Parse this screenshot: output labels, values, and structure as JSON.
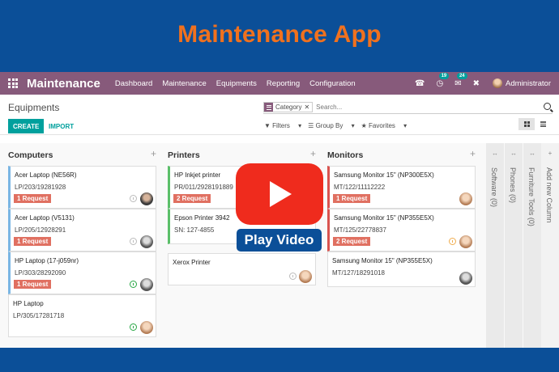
{
  "banner": {
    "title": "Maintenance App"
  },
  "navbar": {
    "brand": "Maintenance",
    "menu": [
      "Dashboard",
      "Maintenance",
      "Equipments",
      "Reporting",
      "Configuration"
    ],
    "activity_badge": "19",
    "messages_badge": "24",
    "user": "Administrator",
    "accent": "#875a7b"
  },
  "control_panel": {
    "breadcrumb": "Equipments",
    "facet": "Category",
    "search_placeholder": "Search...",
    "create": "CREATE",
    "import": "IMPORT",
    "filters": "Filters",
    "group_by": "Group By",
    "favorites": "Favorites"
  },
  "columns": [
    {
      "title": "Computers",
      "cards": [
        {
          "name": "Acer Laptop (NE56R)",
          "ref": "LP/203/19281928",
          "request": "1 Request",
          "status": "grey",
          "avatar": "dark"
        },
        {
          "name": "Acer Laptop (V5131)",
          "ref": "LP/205/12928291",
          "request": "1 Request",
          "status": "grey",
          "avatar": "grey"
        },
        {
          "name": "HP Laptop (17-j059nr)",
          "ref": "LP/303/28292090",
          "request": "1 Request",
          "status": "green",
          "avatar": "grey"
        },
        {
          "name": "HP Laptop",
          "ref": "LP/305/17281718",
          "request": "",
          "status": "green",
          "avatar": "light"
        }
      ]
    },
    {
      "title": "Printers",
      "cards": [
        {
          "name": "HP Inkjet printer",
          "ref": "PR/011/2928191889",
          "request": "2 Request",
          "status": "",
          "avatar": ""
        },
        {
          "name": "Epson Printer 3942",
          "ref": "SN: 127-4855",
          "request": "",
          "status": "",
          "avatar": ""
        },
        {
          "name": "Xerox Printer",
          "ref": "",
          "request": "",
          "status": "grey",
          "avatar": "light"
        }
      ]
    },
    {
      "title": "Monitors",
      "cards": [
        {
          "name": "Samsung Monitor 15\" (NP300E5X)",
          "ref": "MT/122/11112222",
          "request": "1 Request",
          "status": "",
          "avatar": "light"
        },
        {
          "name": "Samsung Monitor 15\" (NP355E5X)",
          "ref": "MT/125/22778837",
          "request": "2 Request",
          "status": "orange",
          "avatar": "light"
        },
        {
          "name": "Samsung Monitor 15\" (NP355E5X)",
          "ref": "MT/127/18291018",
          "request": "",
          "status": "",
          "avatar": "grey"
        }
      ]
    }
  ],
  "folded_columns": [
    "Software (0)",
    "Phones (0)",
    "Furniture Tools (0)"
  ],
  "add_column": "Add new Column",
  "video": {
    "label": "Play Video"
  }
}
